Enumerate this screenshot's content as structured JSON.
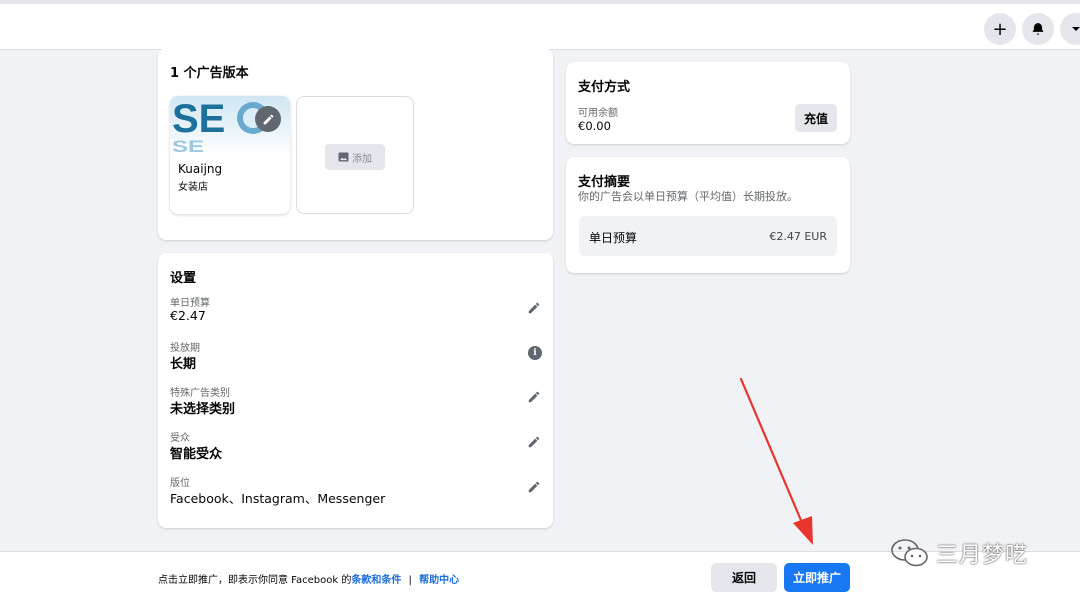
{
  "colors": {
    "accent": "#1877f2",
    "link": "#216fdb",
    "annotation_arrow": "#e8362f"
  },
  "topbar": {
    "buttons": [
      {
        "icon": "plus-icon",
        "label": "+"
      },
      {
        "icon": "bell-icon"
      },
      {
        "icon": "chevron-down-icon"
      }
    ]
  },
  "creatives": {
    "title": "1 个广告版本",
    "items": [
      {
        "name": "Kuaijng",
        "subtitle": "女装店",
        "thumbnail": "seo-image"
      }
    ],
    "add_label": "添加"
  },
  "settings": {
    "title": "设置",
    "rows": [
      {
        "label": "单日预算",
        "value": "€2.47",
        "action_icon": "pencil-icon"
      },
      {
        "label": "投放期",
        "value": "长期",
        "action_icon": "info-icon"
      },
      {
        "label": "特殊广告类别",
        "value": "未选择类别",
        "action_icon": "pencil-icon"
      },
      {
        "label": "受众",
        "value": "智能受众",
        "action_icon": "pencil-icon"
      },
      {
        "label": "版位",
        "value": "Facebook、Instagram、Messenger",
        "action_icon": "pencil-icon"
      }
    ]
  },
  "payment_method": {
    "title": "支付方式",
    "balance_label": "可用余额",
    "balance_value": "€0.00",
    "recharge_label": "充值"
  },
  "payment_summary": {
    "title": "支付摘要",
    "description": "你的广告会以单日预算（平均值）长期投放。",
    "budget_label": "单日预算",
    "budget_value": "€2.47 EUR"
  },
  "footer": {
    "notice_prefix": "点击立即推广，即表示你同意 Facebook 的",
    "terms_link": "条款和条件",
    "separator": "|",
    "help_link": "帮助中心",
    "back_label": "返回",
    "promote_label": "立即推广"
  },
  "watermark": {
    "text": "三月梦呓",
    "icon": "wechat-icon"
  }
}
